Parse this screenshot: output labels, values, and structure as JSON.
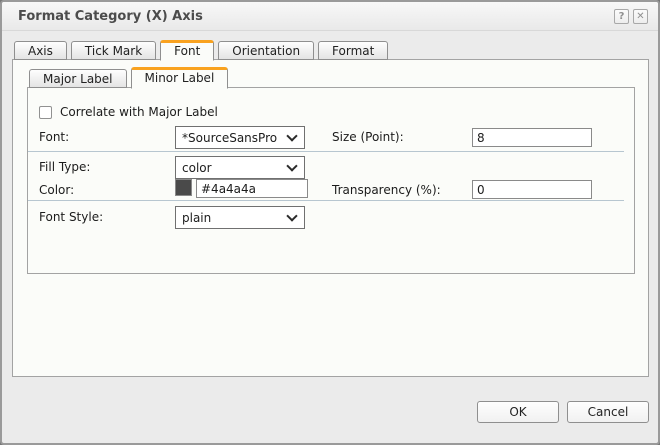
{
  "dialog": {
    "title": "Format Category (X) Axis",
    "help_icon": "?",
    "close_icon": "✕"
  },
  "tabs": [
    {
      "label": "Axis",
      "selected": false
    },
    {
      "label": "Tick Mark",
      "selected": false
    },
    {
      "label": "Font",
      "selected": true
    },
    {
      "label": "Orientation",
      "selected": false
    },
    {
      "label": "Format",
      "selected": false
    }
  ],
  "subtabs": [
    {
      "label": "Major Label",
      "selected": false
    },
    {
      "label": "Minor Label",
      "selected": true
    }
  ],
  "form": {
    "correlate": {
      "label": "Correlate with Major Label",
      "checked": false
    },
    "font": {
      "label": "Font:",
      "value": "*SourceSansPro"
    },
    "size": {
      "label": "Size (Point):",
      "value": "8"
    },
    "fill_type": {
      "label": "Fill Type:",
      "value": "color"
    },
    "color": {
      "label": "Color:",
      "value": "#4a4a4a",
      "swatch_color": "#4a4a4a"
    },
    "transparency": {
      "label": "Transparency (%):",
      "value": "0"
    },
    "font_style": {
      "label": "Font Style:",
      "value": "plain"
    }
  },
  "footer": {
    "ok_label": "OK",
    "cancel_label": "Cancel"
  },
  "colors": {
    "accent_orange": "#f9a21f",
    "separator": "#b7c6d0",
    "swatch": "#4a4a4a",
    "panel_bg": "#fbfcf9",
    "dialog_bg": "#ebebeb"
  }
}
